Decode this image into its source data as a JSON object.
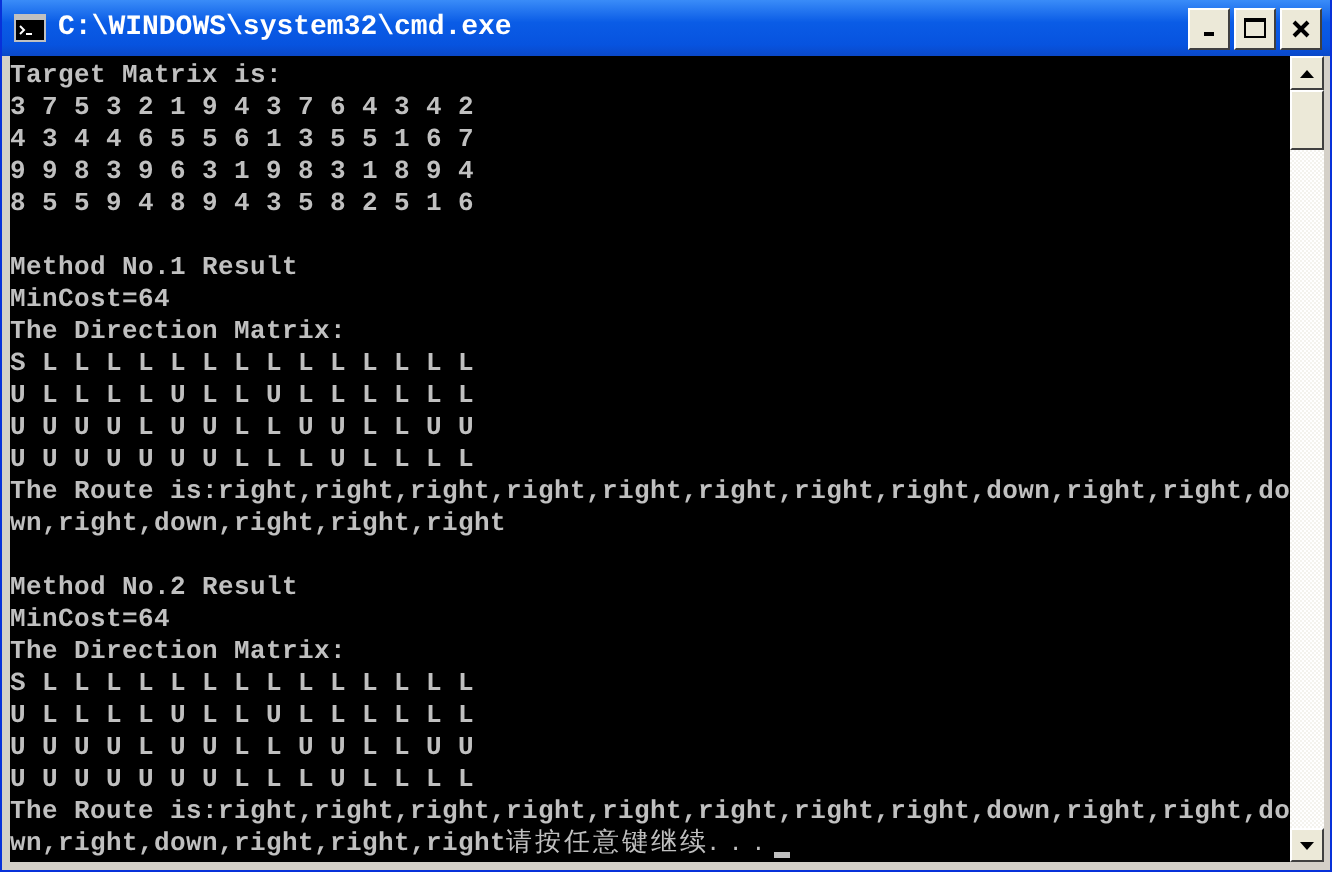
{
  "window": {
    "title": "C:\\WINDOWS\\system32\\cmd.exe"
  },
  "console": {
    "lines": [
      {
        "kind": "text",
        "text": "Target Matrix is:"
      },
      {
        "kind": "text",
        "text": "3 7 5 3 2 1 9 4 3 7 6 4 3 4 2"
      },
      {
        "kind": "text",
        "text": "4 3 4 4 6 5 5 6 1 3 5 5 1 6 7"
      },
      {
        "kind": "text",
        "text": "9 9 8 3 9 6 3 1 9 8 3 1 8 9 4"
      },
      {
        "kind": "text",
        "text": "8 5 5 9 4 8 9 4 3 5 8 2 5 1 6"
      },
      {
        "kind": "blank"
      },
      {
        "kind": "text",
        "text": "Method No.1 Result"
      },
      {
        "kind": "text",
        "text": "MinCost=64"
      },
      {
        "kind": "text",
        "text": "The Direction Matrix:"
      },
      {
        "kind": "text",
        "text": "S L L L L L L L L L L L L L L"
      },
      {
        "kind": "text",
        "text": "U L L L L U L L U L L L L L L"
      },
      {
        "kind": "text",
        "text": "U U U U L U U L L U U L L U U"
      },
      {
        "kind": "text",
        "text": "U U U U U U U L L L U L L L L"
      },
      {
        "kind": "text",
        "text": "The Route is:right,right,right,right,right,right,right,right,down,right,right,do"
      },
      {
        "kind": "text",
        "text": "wn,right,down,right,right,right"
      },
      {
        "kind": "blank"
      },
      {
        "kind": "text",
        "text": "Method No.2 Result"
      },
      {
        "kind": "text",
        "text": "MinCost=64"
      },
      {
        "kind": "text",
        "text": "The Direction Matrix:"
      },
      {
        "kind": "text",
        "text": "S L L L L L L L L L L L L L L"
      },
      {
        "kind": "text",
        "text": "U L L L L U L L U L L L L L L"
      },
      {
        "kind": "text",
        "text": "U U U U L U U L L U U L L U U"
      },
      {
        "kind": "text",
        "text": "U U U U U U U L L L U L L L L"
      },
      {
        "kind": "text",
        "text": "The Route is:right,right,right,right,right,right,right,right,down,right,right,do"
      },
      {
        "kind": "prompt",
        "text": "wn,right,down,right,right,right",
        "prompt": "请按任意键继续. . ."
      }
    ]
  }
}
